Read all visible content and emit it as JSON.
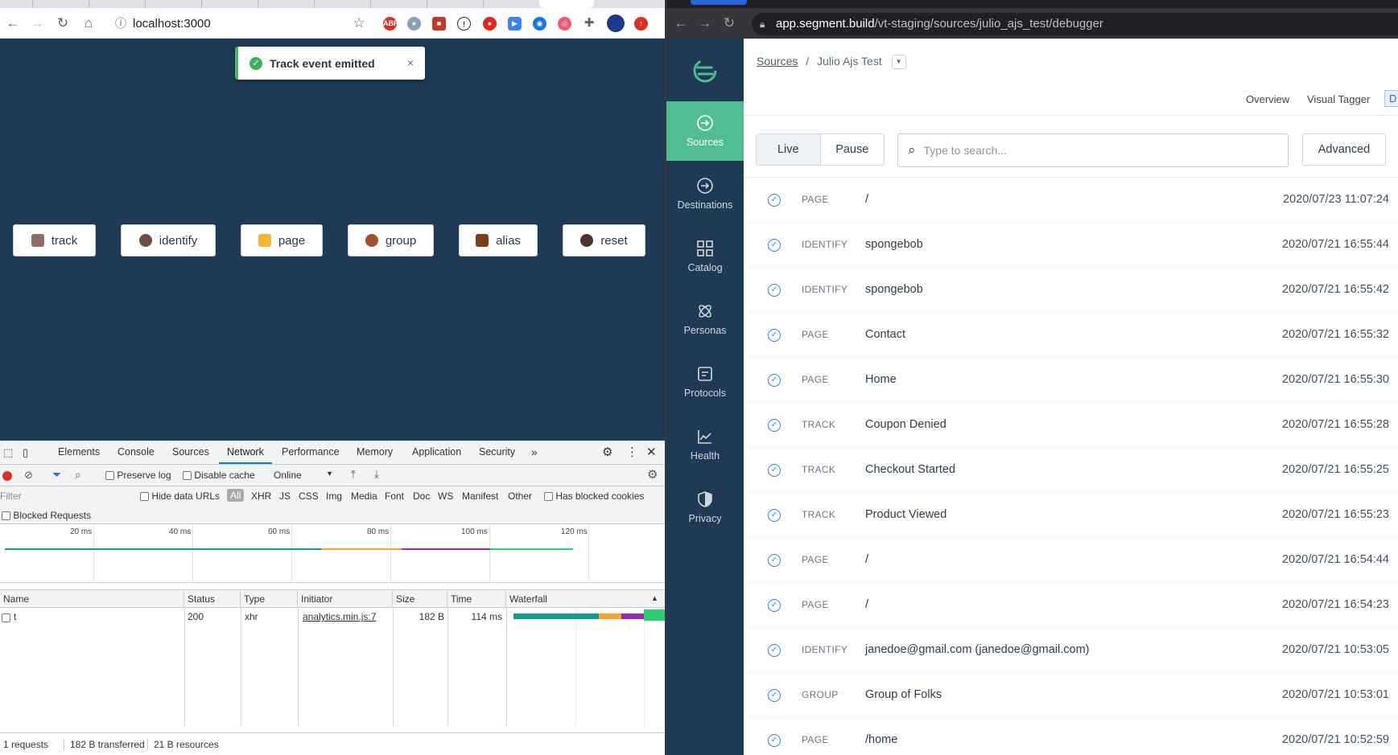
{
  "left_browser": {
    "url": "localhost:3000",
    "toast": {
      "message": "Track event emitted",
      "close": "×"
    },
    "buttons": [
      {
        "label": "track"
      },
      {
        "label": "identify"
      },
      {
        "label": "page"
      },
      {
        "label": "group"
      },
      {
        "label": "alias"
      },
      {
        "label": "reset"
      }
    ]
  },
  "devtools": {
    "tabs": [
      "Elements",
      "Console",
      "Sources",
      "Network",
      "Performance",
      "Memory",
      "Application",
      "Security"
    ],
    "active_tab": "Network",
    "more_tabs": "»",
    "toolbar": {
      "preserve_log": "Preserve log",
      "disable_cache": "Disable cache",
      "throttle": "Online"
    },
    "filter": {
      "placeholder": "Filter",
      "hide_data_urls": "Hide data URLs",
      "all": "All",
      "types": [
        "XHR",
        "JS",
        "CSS",
        "Img",
        "Media",
        "Font",
        "Doc",
        "WS",
        "Manifest",
        "Other"
      ],
      "blocked_cookies": "Has blocked cookies",
      "blocked_requests": "Blocked Requests"
    },
    "timeline_ticks": [
      "20 ms",
      "40 ms",
      "60 ms",
      "80 ms",
      "100 ms",
      "120 ms"
    ],
    "columns": [
      "Name",
      "Status",
      "Type",
      "Initiator",
      "Size",
      "Time",
      "Waterfall"
    ],
    "rows": [
      {
        "name": "t",
        "status": "200",
        "type": "xhr",
        "initiator": "analytics.min.js:7",
        "size": "182 B",
        "time": "114 ms"
      }
    ],
    "status_bar": {
      "requests": "1 requests",
      "transferred": "182 B transferred",
      "resources": "21 B resources"
    }
  },
  "right_browser": {
    "url_host": "app.segment.build",
    "url_path": "/vt-staging/sources/julio_ajs_test/debugger",
    "sidebar": [
      {
        "label": "Sources",
        "icon": "sources-icon"
      },
      {
        "label": "Destinations",
        "icon": "destinations-icon"
      },
      {
        "label": "Catalog",
        "icon": "catalog-icon"
      },
      {
        "label": "Personas",
        "icon": "personas-icon"
      },
      {
        "label": "Protocols",
        "icon": "protocols-icon"
      },
      {
        "label": "Health",
        "icon": "health-icon"
      },
      {
        "label": "Privacy",
        "icon": "privacy-icon"
      }
    ],
    "breadcrumb": {
      "root": "Sources",
      "sep": "/",
      "current": "Julio Ajs Test"
    },
    "top_nav": [
      "Overview",
      "Visual Tagger",
      "D"
    ],
    "controls": {
      "live": "Live",
      "pause": "Pause",
      "search_placeholder": "Type to search...",
      "advanced": "Advanced"
    },
    "events": [
      {
        "type": "PAGE",
        "name": "/",
        "time": "2020/07/23 11:07:24"
      },
      {
        "type": "IDENTIFY",
        "name": "spongebob",
        "time": "2020/07/21 16:55:44"
      },
      {
        "type": "IDENTIFY",
        "name": "spongebob",
        "time": "2020/07/21 16:55:42"
      },
      {
        "type": "PAGE",
        "name": "Contact",
        "time": "2020/07/21 16:55:32"
      },
      {
        "type": "PAGE",
        "name": "Home",
        "time": "2020/07/21 16:55:30"
      },
      {
        "type": "TRACK",
        "name": "Coupon Denied",
        "time": "2020/07/21 16:55:28"
      },
      {
        "type": "TRACK",
        "name": "Checkout Started",
        "time": "2020/07/21 16:55:25"
      },
      {
        "type": "TRACK",
        "name": "Product Viewed",
        "time": "2020/07/21 16:55:23"
      },
      {
        "type": "PAGE",
        "name": "/",
        "time": "2020/07/21 16:54:44"
      },
      {
        "type": "PAGE",
        "name": "/",
        "time": "2020/07/21 16:54:23"
      },
      {
        "type": "IDENTIFY",
        "name": "janedoe@gmail.com (janedoe@gmail.com)",
        "time": "2020/07/21 10:53:05"
      },
      {
        "type": "GROUP",
        "name": "Group of Folks",
        "time": "2020/07/21 10:53:01"
      },
      {
        "type": "PAGE",
        "name": "/home",
        "time": "2020/07/21 10:52:59"
      }
    ]
  },
  "colors": {
    "segment_green": "#52bd94",
    "navy": "#1f3a54",
    "check_blue": "#2c86d2",
    "toast_green": "#3fb15e"
  }
}
